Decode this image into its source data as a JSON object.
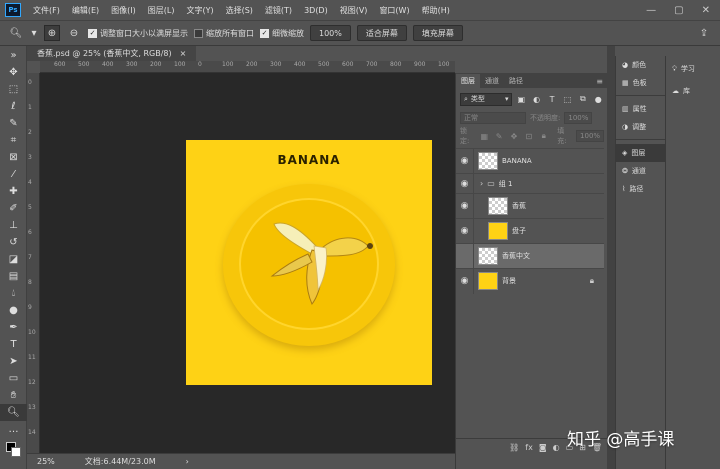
{
  "app": {
    "logo_text": "Ps"
  },
  "menu": [
    "文件(F)",
    "编辑(E)",
    "图像(I)",
    "图层(L)",
    "文字(Y)",
    "选择(S)",
    "滤镜(T)",
    "3D(D)",
    "视图(V)",
    "窗口(W)",
    "帮助(H)"
  ],
  "options": {
    "resize_windows_label": "调整窗口大小以满屏显示",
    "zoom_all_label": "缩放所有窗口",
    "scrubby_zoom_label": "细微缩放",
    "zoom_pct_label": "100%",
    "fit_screen_label": "适合屏幕",
    "fill_screen_label": "填充屏幕"
  },
  "document": {
    "tab_title": "香蕉.psd @ 25% (香蕉中文, RGB/8)",
    "close_glyph": "×",
    "artboard_title": "BANANA",
    "ruler_top": [
      "600",
      "500",
      "400",
      "300",
      "200",
      "100",
      "0",
      "100",
      "200",
      "300",
      "400",
      "500",
      "600",
      "700",
      "800",
      "900",
      "100"
    ],
    "ruler_left": [
      "0",
      "1",
      "2",
      "3",
      "4",
      "5",
      "6",
      "7",
      "8",
      "9",
      "10",
      "11",
      "12",
      "13",
      "14"
    ]
  },
  "status": {
    "zoom": "25%",
    "doc_size": "文档:6.44M/23.0M"
  },
  "layers_panel": {
    "tabs": [
      "图层",
      "通道",
      "路径"
    ],
    "filter_label": "类型",
    "blend_mode": "正常",
    "opacity_label": "不透明度:",
    "opacity_value": "100%",
    "lock_label": "锁定:",
    "fill_label": "填充:",
    "fill_value": "100%",
    "layers": [
      {
        "name": "BANANA",
        "visible": true
      },
      {
        "name": "组 1",
        "visible": true
      },
      {
        "name": "香蕉",
        "visible": true
      },
      {
        "name": "盘子",
        "visible": true
      },
      {
        "name": "香蕉中文",
        "visible": false,
        "selected": true
      },
      {
        "name": "背景",
        "visible": true,
        "locked": true
      }
    ]
  },
  "dock": {
    "group1": [
      "颜色",
      "色板"
    ],
    "group2": [
      "属性",
      "调整"
    ],
    "group3": [
      "图层",
      "通道",
      "路径"
    ],
    "group4": [
      "学习",
      "库"
    ]
  },
  "watermark": "知乎 @高手课"
}
